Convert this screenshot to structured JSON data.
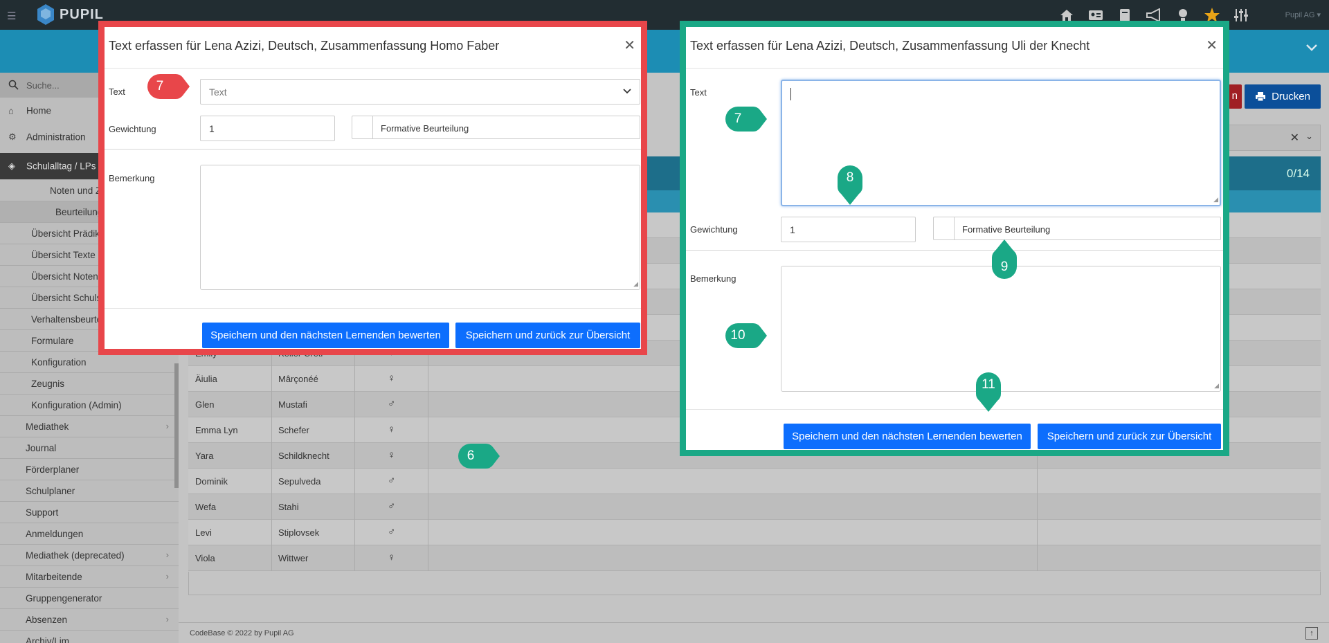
{
  "topbar": {
    "logo_text": "PUPIL",
    "user": "Pupil AG ▾",
    "icons": [
      "home-icon",
      "id-card-icon",
      "book-icon",
      "megaphone-icon",
      "lightbulb-icon",
      "star-icon",
      "sliders-icon"
    ]
  },
  "sidebar": {
    "search_placeholder": "Suche...",
    "main": [
      {
        "label": "Home",
        "icon": "home-icon"
      },
      {
        "label": "Administration",
        "icon": "cogs-icon"
      },
      {
        "label": "Schulalltag / LPs",
        "icon": "graduation-cap-icon"
      }
    ],
    "group_label": "Noten und Zeugnisse",
    "sub_items": [
      "Beurteilungen",
      "Übersicht Prädikate",
      "Übersicht Texte",
      "Übersicht Noten",
      "Übersicht Schulstufen",
      "Verhaltensbeurteilung",
      "Formulare",
      "Konfiguration",
      "Zeugnis",
      "Konfiguration (Admin)"
    ],
    "items": [
      "Mediathek",
      "Journal",
      "Förderplaner",
      "Schulplaner",
      "Support",
      "Anmeldungen",
      "Mediathek (deprecated)",
      "Mitarbeitende",
      "Gruppengenerator",
      "Absenzen",
      "Archiv/Lim..."
    ]
  },
  "toolbar": {
    "partial_label": "n",
    "print_label": "Drucken"
  },
  "table": {
    "count": "0/14",
    "rows": [
      {
        "first": "Emily",
        "last": "Keller Creti",
        "sex": "♀"
      },
      {
        "first": "Äiulia",
        "last": "Mârçonéé",
        "sex": "♀"
      },
      {
        "first": "Glen",
        "last": "Mustafi",
        "sex": "♂"
      },
      {
        "first": "Emma Lyn",
        "last": "Schefer",
        "sex": "♀"
      },
      {
        "first": "Yara",
        "last": "Schildknecht",
        "sex": "♀"
      },
      {
        "first": "Dominik",
        "last": "Sepulveda",
        "sex": "♂"
      },
      {
        "first": "Wefa",
        "last": "Stahi",
        "sex": "♂"
      },
      {
        "first": "Levi",
        "last": "Stiplovsek",
        "sex": "♂"
      },
      {
        "first": "Viola",
        "last": "Wittwer",
        "sex": "♀"
      }
    ]
  },
  "footer": {
    "text": "CodeBase © 2022 by Pupil AG"
  },
  "modal_a": {
    "title": "Text erfassen für Lena Azizi, Deutsch, Zusammenfassung Homo Faber",
    "text_label": "Text",
    "text_select_value": "Text",
    "weight_label": "Gewichtung",
    "weight_value": "1",
    "formative_label": "Formative Beurteilung",
    "remark_label": "Bemerkung",
    "save_next": "Speichern und den nächsten Lernenden bewerten",
    "save_back": "Speichern und zurück zur Übersicht"
  },
  "modal_b": {
    "title": "Text erfassen für Lena Azizi, Deutsch, Zusammenfassung Uli der Knecht",
    "text_label": "Text",
    "weight_label": "Gewichtung",
    "weight_value": "1",
    "formative_label": "Formative Beurteilung",
    "remark_label": "Bemerkung",
    "save_next": "Speichern und den nächsten Lernenden bewerten",
    "save_back": "Speichern und zurück zur Übersicht"
  },
  "markers": {
    "m6": "6",
    "m7a": "7",
    "m7b": "7",
    "m8": "8",
    "m9": "9",
    "m10": "10",
    "m11": "11"
  },
  "colors": {
    "red_marker": "#e8464a",
    "teal_marker": "#1aa886",
    "primary_button": "#0d6efd"
  }
}
